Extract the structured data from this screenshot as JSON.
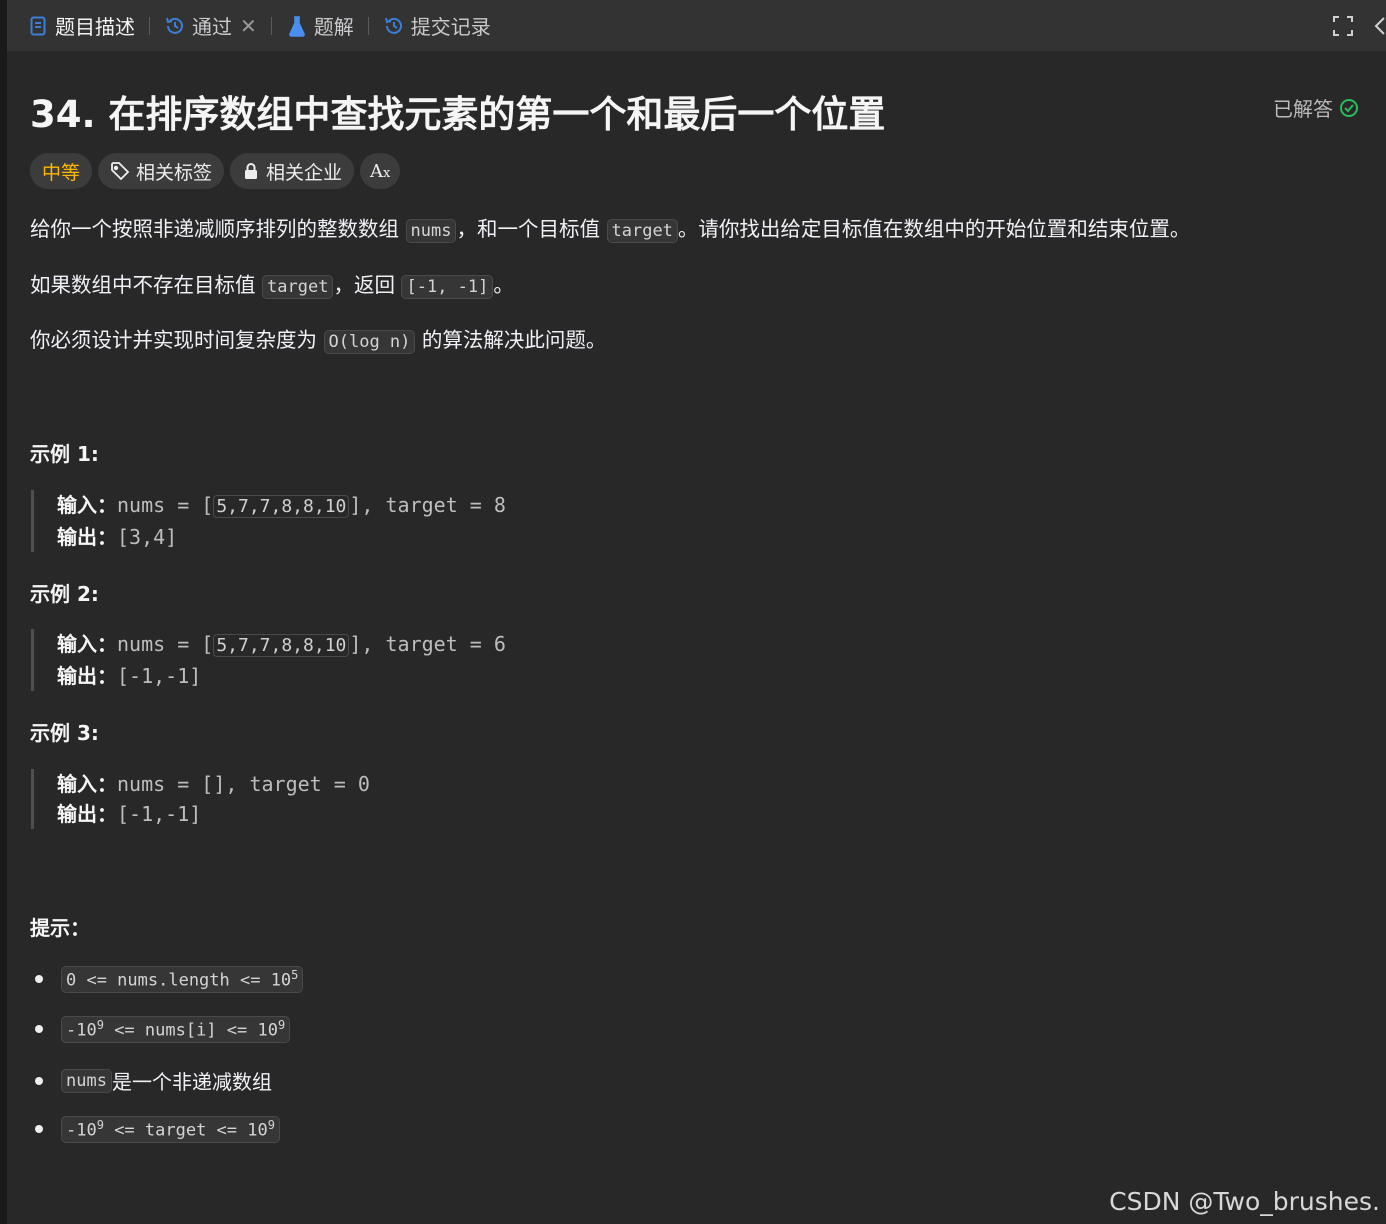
{
  "tabs": {
    "description": "题目描述",
    "submission": "通过",
    "solutions": "题解",
    "history": "提交记录"
  },
  "problem": {
    "title": "34. 在排序数组中查找元素的第一个和最后一个位置",
    "status": "已解答",
    "difficulty": "中等",
    "tag_topics": "相关标签",
    "tag_companies": "相关企业",
    "tag_font": "Aあ"
  },
  "description": {
    "p1_a": "给你一个按照非递减顺序排列的整数数组 ",
    "p1_code1": "nums",
    "p1_b": "，和一个目标值 ",
    "p1_code2": "target",
    "p1_c": "。请你找出给定目标值在数组中的开始位置和结束位置。",
    "p2_a": "如果数组中不存在目标值 ",
    "p2_code1": "target",
    "p2_b": "，返回 ",
    "p2_code2": "[-1, -1]",
    "p2_c": "。",
    "p3_a": "你必须设计并实现时间复杂度为 ",
    "p3_code": "O(log n)",
    "p3_b": " 的算法解决此问题。"
  },
  "examples": [
    {
      "heading": "示例 1:",
      "in_label": "输入：",
      "in_pre": "nums = [",
      "in_arr": "5,7,7,8,8,10",
      "in_post": "], target = 8",
      "out_label": "输出：",
      "out": "[3,4]"
    },
    {
      "heading": "示例 2:",
      "in_label": "输入：",
      "in_pre": "nums = [",
      "in_arr": "5,7,7,8,8,10",
      "in_post": "], target = 6",
      "out_label": "输出：",
      "out": "[-1,-1]"
    },
    {
      "heading": "示例 3:",
      "in_label": "输入：",
      "in_pre": "nums = [], target = 0",
      "in_arr": "",
      "in_post": "",
      "out_label": "输出：",
      "out": "[-1,-1]"
    }
  ],
  "hints": {
    "heading": "提示：",
    "c1_pre": "0 <= nums.length <= 10",
    "c1_sup": "5",
    "c2_a": "-10",
    "c2_sup1": "9",
    "c2_b": " <= nums[i] <= 10",
    "c2_sup2": "9",
    "c3_code": "nums",
    "c3_text": " 是一个非递减数组",
    "c4_a": "-10",
    "c4_sup1": "9",
    "c4_b": " <= target <= 10",
    "c4_sup2": "9"
  },
  "watermark": "CSDN @Two_brushes.",
  "colors": {
    "accent": "#ffb800",
    "success": "#2cbb5d",
    "tab_icon": "#3d7fd6",
    "flask_icon": "#4a8ef0"
  }
}
